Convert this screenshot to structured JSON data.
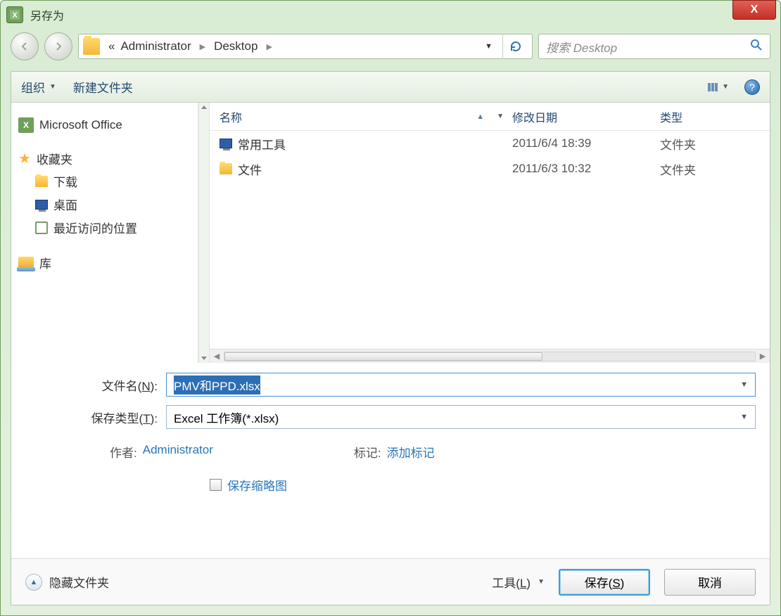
{
  "window": {
    "title": "另存为"
  },
  "nav": {
    "breadcrumb": {
      "overflow": "«",
      "seg1": "Administrator",
      "seg2": "Desktop"
    },
    "search_placeholder": "搜索 Desktop"
  },
  "toolbar": {
    "organize": "组织",
    "new_folder": "新建文件夹"
  },
  "sidebar": {
    "office": "Microsoft Office",
    "favorites": "收藏夹",
    "downloads": "下载",
    "desktop": "桌面",
    "recent": "最近访问的位置",
    "libraries": "库"
  },
  "columns": {
    "name": "名称",
    "date": "修改日期",
    "type": "类型"
  },
  "files": [
    {
      "name": "常用工具",
      "date": "2011/6/4 18:39",
      "type": "文件夹",
      "icon": "monitor"
    },
    {
      "name": "文件",
      "date": "2011/6/3 10:32",
      "type": "文件夹",
      "icon": "folder"
    }
  ],
  "form": {
    "filename_label_pre": "文件名(",
    "filename_label_key": "N",
    "filename_label_post": "):",
    "filename_value": "PMV和PPD.xlsx",
    "savetype_label_pre": "保存类型(",
    "savetype_label_key": "T",
    "savetype_label_post": "):",
    "savetype_value": "Excel 工作簿(*.xlsx)",
    "author_label": "作者:",
    "author_value": "Administrator",
    "tags_label": "标记:",
    "tags_value": "添加标记",
    "thumbnail_label": "保存缩略图"
  },
  "bottom": {
    "hide_folders": "隐藏文件夹",
    "tools_pre": "工具(",
    "tools_key": "L",
    "tools_post": ")",
    "save_pre": "保存(",
    "save_key": "S",
    "save_post": ")",
    "cancel": "取消"
  },
  "close_glyph": "X"
}
